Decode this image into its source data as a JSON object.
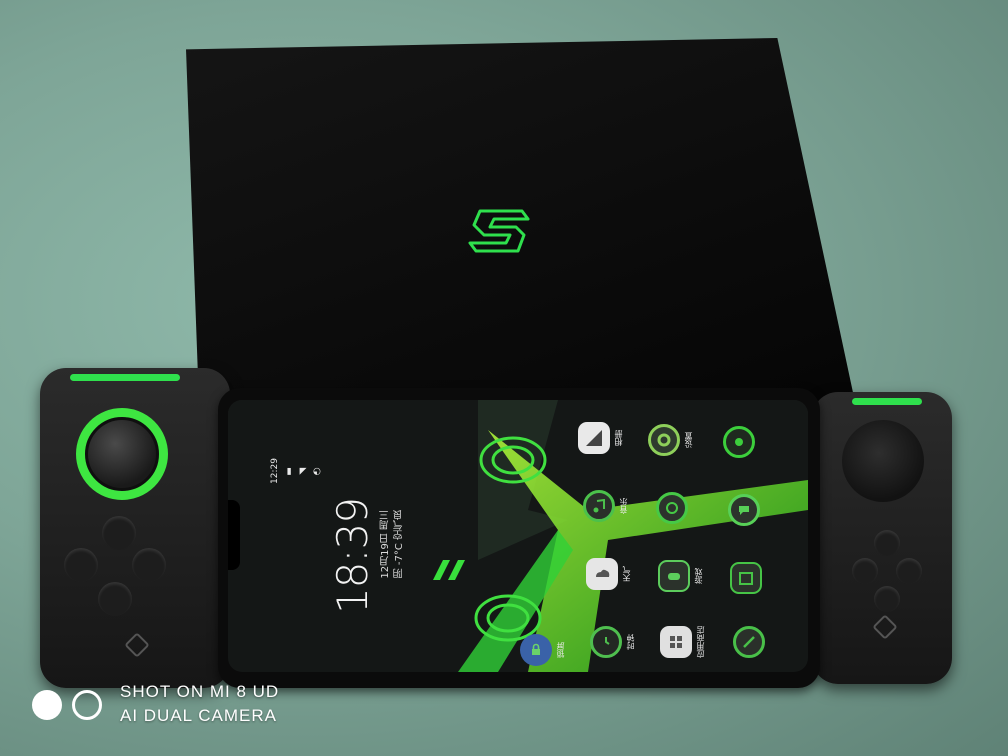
{
  "photo": {
    "subject": "Gaming phone with detachable gamepad controllers in front of its black retail box"
  },
  "phone_screen": {
    "status_time": "12:29",
    "clock_time": "18:39",
    "clock_date": "12月19日 周三",
    "clock_weather": "阴 -7°C 空气良",
    "apps": [
      {
        "label": "相册",
        "icon": "gallery-icon",
        "color": "#f0f0f0"
      },
      {
        "label": "设置",
        "icon": "settings-icon",
        "color": "#8ecf5a"
      },
      {
        "label": "",
        "icon": "camera-icon",
        "color": "#3ccf3c"
      },
      {
        "label": "音乐",
        "icon": "music-icon",
        "color": "#4bc14b"
      },
      {
        "label": "",
        "icon": "browser-icon",
        "color": "#46c946"
      },
      {
        "label": "",
        "icon": "messages-icon",
        "color": "#57d057"
      },
      {
        "label": "天气",
        "icon": "weather-icon",
        "color": "#e6e6e6"
      },
      {
        "label": "游戏",
        "icon": "games-icon",
        "color": "#5ccc5c"
      },
      {
        "label": "",
        "icon": "calendar-icon",
        "color": "#46c446"
      },
      {
        "label": "锁屏",
        "icon": "lock-icon",
        "color": "#6ad36a"
      },
      {
        "label": "时钟",
        "icon": "clock-icon",
        "color": "#4fbf4f"
      },
      {
        "label": "应用商店",
        "icon": "app-store-icon",
        "color": "#e0e0e0"
      },
      {
        "label": "",
        "icon": "tools-icon",
        "color": "#49c049"
      }
    ]
  },
  "watermark": {
    "line1": "SHOT ON MI 8 UD",
    "line2": "AI DUAL CAMERA"
  },
  "colors": {
    "accent_green": "#2fe04d",
    "background_cloth": "#7ea597",
    "box_black": "#0c0c0c"
  }
}
